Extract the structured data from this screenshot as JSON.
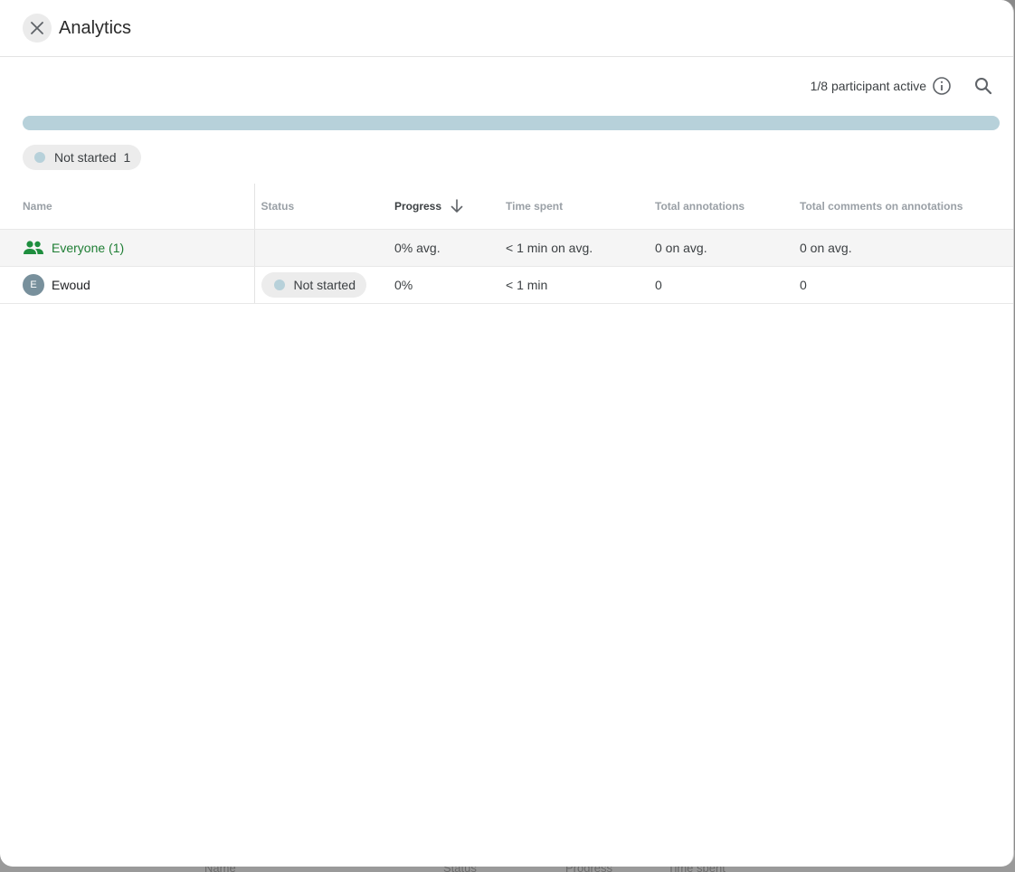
{
  "header": {
    "title": "Analytics"
  },
  "toolbar": {
    "active_text": "1/8 participant active"
  },
  "progress": {
    "fraction_complete": 0
  },
  "filter_chip": {
    "label": "Not started",
    "count": "1"
  },
  "table": {
    "columns": {
      "name": "Name",
      "status": "Status",
      "progress": "Progress",
      "time_spent": "Time spent",
      "total_annotations": "Total annotations",
      "total_comments": "Total comments on annotations"
    },
    "summary_row": {
      "name": "Everyone (1)",
      "progress": "0% avg.",
      "time_spent": "< 1 min on avg.",
      "total_annotations": "0 on avg.",
      "total_comments": "0 on avg."
    },
    "rows": [
      {
        "avatar_letter": "E",
        "name": "Ewoud",
        "status": "Not started",
        "progress": "0%",
        "time_spent": "< 1 min",
        "total_annotations": "0",
        "total_comments": "0"
      }
    ]
  },
  "background": {
    "peek_labels": [
      "Name",
      "Status",
      "Progress",
      "Time spent"
    ]
  },
  "colors": {
    "accent_green": "#1e8e3e",
    "not_started": "#b7d1da",
    "avatar": "#78909c"
  }
}
